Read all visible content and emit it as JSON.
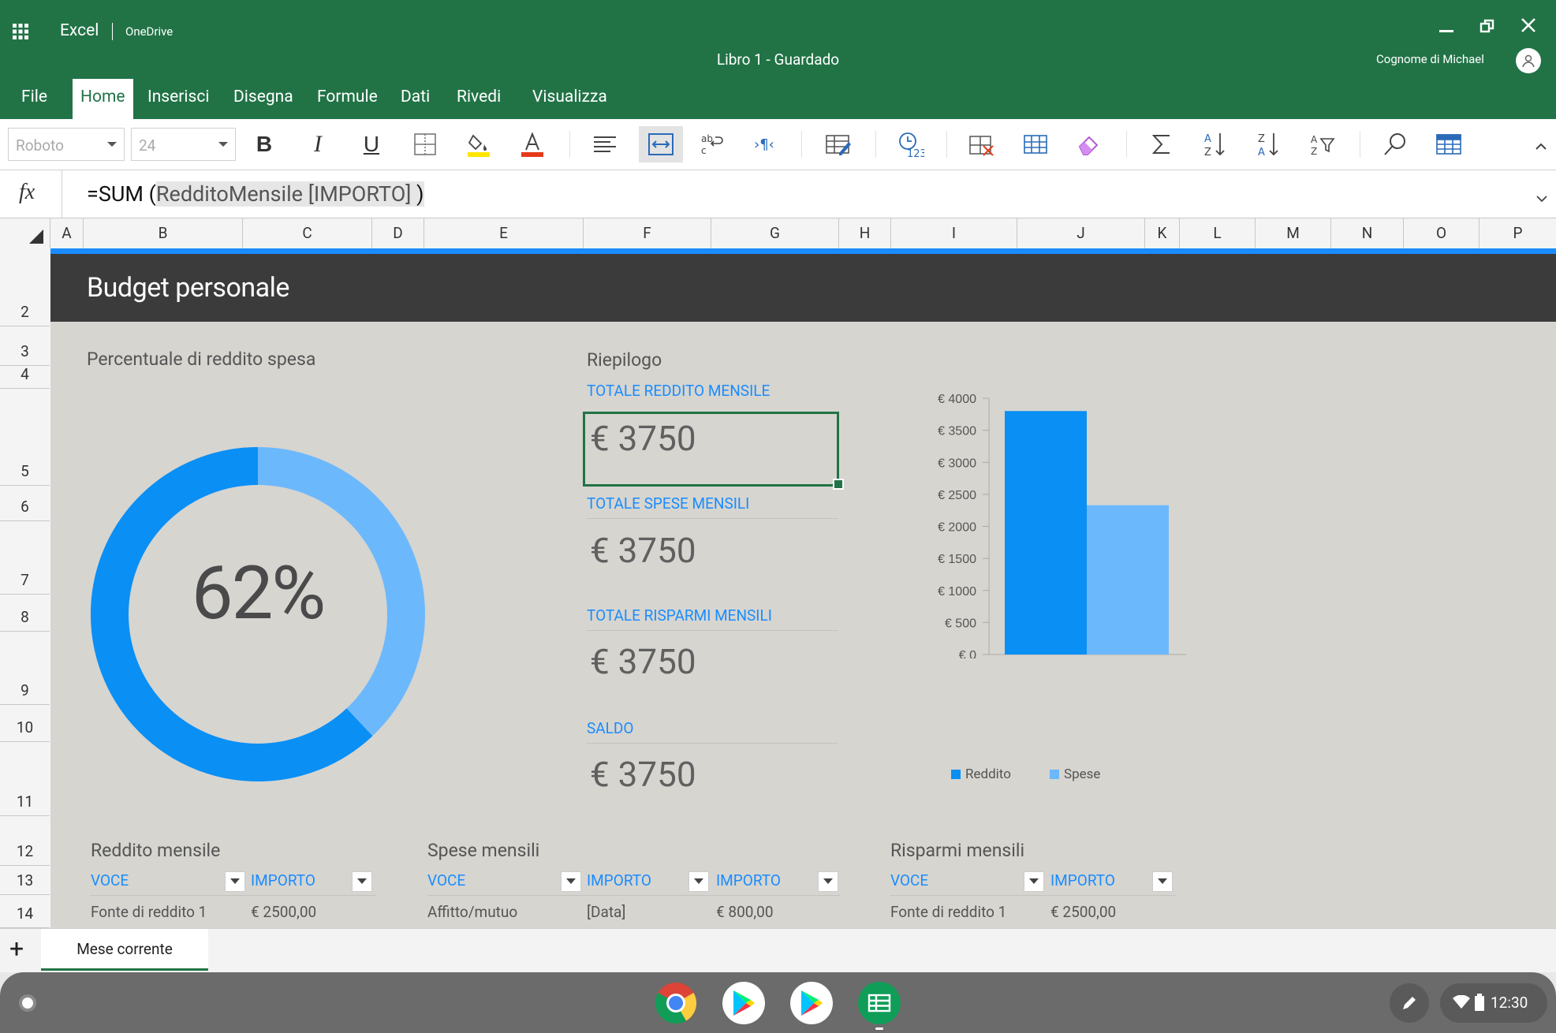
{
  "app": {
    "name": "Excel",
    "location": "OneDrive",
    "doc_title": "Libro 1 - Guardado",
    "user": "Cognome di Michael"
  },
  "ribbon": {
    "tabs": [
      "File",
      "Home",
      "Inserisci",
      "Disegna",
      "Formule",
      "Dati",
      "Rivedi",
      "Visualizza"
    ],
    "active": "Home"
  },
  "toolbar": {
    "font_name": "Roboto",
    "font_size": "24",
    "bold": "B",
    "italic": "I",
    "underline": "U"
  },
  "formula": {
    "fx": "fx",
    "prefix": "=SUM (",
    "highlight": "RedditoMensile [IMPORTO]",
    "suffix": " )"
  },
  "columns": [
    "A",
    "B",
    "C",
    "D",
    "E",
    "F",
    "G",
    "H",
    "I",
    "J",
    "K",
    "L",
    "M",
    "N",
    "O",
    "P"
  ],
  "rows": [
    "2",
    "3",
    "4",
    "5",
    "6",
    "7",
    "8",
    "9",
    "10",
    "11",
    "12",
    "13",
    "14"
  ],
  "sheet": {
    "banner_title": "Budget personale",
    "donut": {
      "title": "Percentuale di reddito spesa",
      "value_label": "62%",
      "percent": 62
    },
    "summary": {
      "title": "Riepilogo",
      "items": [
        {
          "label": "TOTALE REDDITO MENSILE",
          "value": "€ 3750"
        },
        {
          "label": "TOTALE SPESE MENSILI",
          "value": "€ 3750"
        },
        {
          "label": "TOTALE RISPARMI MENSILI",
          "value": "€ 3750"
        },
        {
          "label": "SALDO",
          "value": "€ 3750"
        }
      ]
    },
    "tables": {
      "income": {
        "title": "Reddito mensile",
        "headers": [
          "VOCE",
          "IMPORTO"
        ],
        "row": [
          "Fonte di reddito 1",
          "€ 2500,00"
        ]
      },
      "expenses": {
        "title": "Spese mensili",
        "headers": [
          "VOCE",
          "IMPORTO",
          "IMPORTO"
        ],
        "row": [
          "Affitto/mutuo",
          "[Data]",
          "€ 800,00"
        ]
      },
      "savings": {
        "title": "Risparmi mensili",
        "headers": [
          "VOCE",
          "IMPORTO"
        ],
        "row": [
          "Fonte di reddito 1",
          "€ 2500,00"
        ]
      }
    }
  },
  "chart_data": {
    "type": "bar",
    "categories": [
      "Reddito",
      "Spese"
    ],
    "values": [
      3800,
      2330
    ],
    "ylim": [
      0,
      4000
    ],
    "yticks": [
      "€ 0",
      "€ 500",
      "€ 1000",
      "€ 1500",
      "€ 2000",
      "€ 2500",
      "€ 3000",
      "€ 3500",
      "€ 4000"
    ],
    "legend": [
      "Reddito",
      "Spese"
    ],
    "legend_position": "bottom",
    "colors": [
      "#0a8ff5",
      "#6cb8fc"
    ]
  },
  "sheet_tabs": {
    "add": "+",
    "active": "Mese corrente"
  },
  "taskbar": {
    "time": "12:30",
    "apps": [
      "chrome-icon",
      "play-store-icon",
      "play-store-icon",
      "sheets-icon"
    ]
  },
  "colors": {
    "excel_green": "#217346",
    "accent_blue": "#1a8cff",
    "banner": "#3b3b3b",
    "donut_dark": "#0a8ff5",
    "donut_light": "#6cb8fc"
  }
}
